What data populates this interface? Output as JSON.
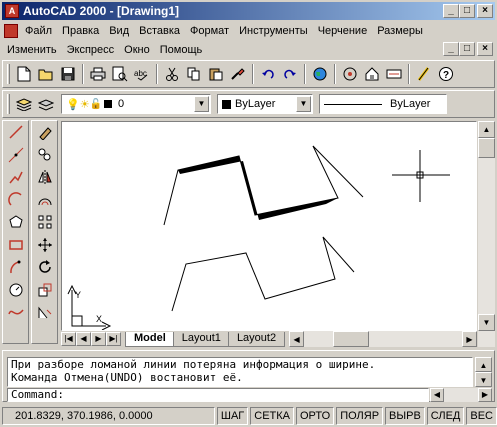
{
  "window": {
    "title": "AutoCAD 2000 - [Drawing1]",
    "min_glyph": "_",
    "max_glyph": "□",
    "close_glyph": "×"
  },
  "menu": {
    "row1": [
      "Файл",
      "Правка",
      "Вид",
      "Вставка",
      "Формат",
      "Инструменты",
      "Черчение",
      "Размеры"
    ],
    "row2": [
      "Изменить",
      "Экспресс",
      "Окно",
      "Помощь"
    ]
  },
  "layer_toolbar": {
    "layer_value": "0",
    "color_value": "ByLayer",
    "linetype_value": "ByLayer"
  },
  "layout_tabs": [
    "Model",
    "Layout1",
    "Layout2"
  ],
  "command_window": {
    "history": [
      "При разборе ломаной линии потеряна информация о ширине.",
      "Команда Отмена(UNDO) востановит её."
    ],
    "prompt": "Command:"
  },
  "status_bar": {
    "coordinates": "201.8329, 370.1986, 0.0000",
    "buttons": [
      "ШАГ",
      "СЕТКА",
      "ОРТО",
      "ПОЛЯР",
      "ВЫРВ",
      "СЛЕД",
      "ВЕС"
    ]
  },
  "icons": {
    "standard_toolbar": [
      "new-icon",
      "open-icon",
      "save-icon",
      "print-icon",
      "print-preview-icon",
      "spell-check-icon",
      "cut-icon",
      "copy-icon",
      "paste-icon",
      "match-properties-icon",
      "undo-icon",
      "redo-icon",
      "web-icon",
      "pan-realtime-icon",
      "zoom-realtime-icon",
      "zoom-window-icon",
      "properties-icon",
      "help-icon"
    ],
    "draw_toolbar": [
      "line-icon",
      "xline-icon",
      "polyline-icon",
      "polygon-icon",
      "rectangle-icon",
      "arc-icon",
      "circle-icon",
      "spline-icon",
      "ellipse-icon"
    ],
    "modify_toolbar": [
      "erase-icon",
      "copy-object-icon",
      "mirror-icon",
      "offset-icon",
      "array-icon",
      "move-icon",
      "rotate-icon",
      "scale-icon",
      "stretch-icon"
    ]
  },
  "colors": {
    "title_start": "#0a246a",
    "title_end": "#a6caf0",
    "face": "#d4d0c8",
    "canvas": "#ffffff"
  }
}
